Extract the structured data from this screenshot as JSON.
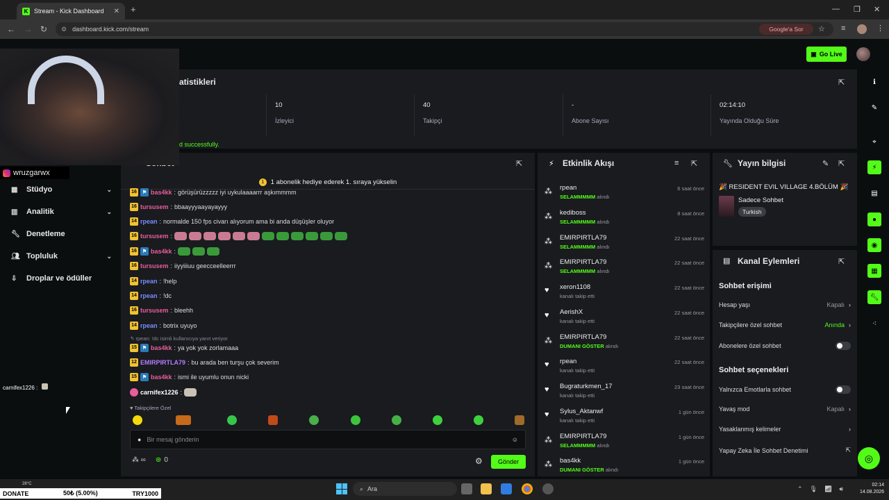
{
  "browser": {
    "tab_title": "Stream - Kick Dashboard",
    "url": "dashboard.kick.com/stream",
    "google_sor": "Google'a Sor"
  },
  "header": {
    "go_live": "Go Live"
  },
  "overlay": {
    "instagram": "wruzgarwx",
    "cam_feed_user": "carnifex1226 :",
    "donate": {
      "label": "DONATE",
      "progress": "50₺ (5.00%)",
      "goal": "TRY1000"
    },
    "weather": "28°C"
  },
  "nav": {
    "items": [
      {
        "label": "Stüdyo",
        "icon": "studio-icon",
        "has_chevron": true
      },
      {
        "label": "Analitik",
        "icon": "chart-icon",
        "has_chevron": true
      },
      {
        "label": "Denetleme",
        "icon": "wrench-icon",
        "has_chevron": false
      },
      {
        "label": "Topluluk",
        "icon": "people-icon",
        "has_chevron": true
      },
      {
        "label": "Droplar ve ödüller",
        "icon": "drops-icon",
        "has_chevron": false
      }
    ]
  },
  "stats": {
    "title": "atistikleri",
    "items": [
      {
        "value": "10",
        "label": "İzleyici"
      },
      {
        "value": "40",
        "label": "Takipçi"
      },
      {
        "value": "-",
        "label": "Abone Sayısı"
      },
      {
        "value": "02:14:10",
        "label": "Yayında Olduğu Süre"
      }
    ],
    "status": "d successfully."
  },
  "chat": {
    "title": "Sohbet",
    "gift_banner": "1 abonelik hediye ederek 1. sıraya yükselin",
    "messages": [
      {
        "badge": "16",
        "kick": true,
        "user": "bas4kk",
        "text": "görüşürüzzzzz iyi uykulaaaarrr aşkımmmm",
        "color": "#e85d9c"
      },
      {
        "badge": "16",
        "kick": false,
        "user": "tursusem",
        "text": "bbaayyyaayayayyy",
        "color": "#e85d9c"
      },
      {
        "badge": "14",
        "kick": false,
        "user": "rpean",
        "text": "normalde 150 fps civarı alıyorum ama bi anda düşüşler oluyor",
        "color": "#7b8cff"
      },
      {
        "badge": "16",
        "kick": false,
        "user": "tursusem",
        "text": "",
        "color": "#e85d9c"
      },
      {
        "badge": "16",
        "kick": true,
        "user": "bas4kk",
        "text": "",
        "color": "#e85d9c"
      },
      {
        "badge": "16",
        "kick": false,
        "user": "tursusem",
        "text": "iiyyiiiuu geecceelleerrr",
        "color": "#e85d9c"
      },
      {
        "badge": "14",
        "kick": false,
        "user": "rpean",
        "text": "!help",
        "color": "#7b8cff"
      },
      {
        "badge": "14",
        "kick": false,
        "user": "rpean",
        "text": "!dc",
        "color": "#7b8cff"
      },
      {
        "badge": "16",
        "kick": false,
        "user": "tursusem",
        "text": "bleehh",
        "color": "#e85d9c"
      },
      {
        "badge": "14",
        "kick": false,
        "user": "rpean",
        "text": "botrix uyuyo",
        "color": "#7b8cff"
      },
      {
        "badge": "15",
        "kick": true,
        "user": "bas4kk",
        "text": "ya yok yok zorlamaaa",
        "color": "#e85d9c"
      },
      {
        "badge": "12",
        "kick": false,
        "user": "EMIRPIRTLA79",
        "text": "bu arada ben turşu çok severim",
        "color": "#b67bff"
      },
      {
        "badge": "15",
        "kick": true,
        "user": "bas4kk",
        "text": "ismi ile uyumlu onun nicki",
        "color": "#e85d9c"
      },
      {
        "badge": "",
        "kick": false,
        "user": "carnifex1226",
        "text": "",
        "color": "#ffffff"
      }
    ],
    "reply_hint": "↰ rpean: !dc isimli kullanıcıya yanıt veriyor",
    "follow_only": "♥ Takipçilere Özel",
    "input_placeholder": "Bir mesaj gönderin",
    "points": "0",
    "send": "Gönder"
  },
  "feed": {
    "title": "Etkinlik Akışı",
    "items": [
      {
        "type": "points",
        "user": "rpean",
        "reward": "SELAMMMMM",
        "suffix": " alındı",
        "time": "6 saat önce"
      },
      {
        "type": "points",
        "user": "kediboss",
        "reward": "SELAMMMMM",
        "suffix": " alındı",
        "time": "8 saat önce"
      },
      {
        "type": "points",
        "user": "EMIRPIRTLA79",
        "reward": "SELAMMMMM",
        "suffix": " alındı",
        "time": "22 saat önce"
      },
      {
        "type": "points",
        "user": "EMIRPIRTLA79",
        "reward": "SELAMMMMM",
        "suffix": " alındı",
        "time": "22 saat önce"
      },
      {
        "type": "follow",
        "user": "xeron1108",
        "reward": "",
        "suffix": "kanalı takip etti",
        "time": "22 saat önce"
      },
      {
        "type": "follow",
        "user": "AerishX",
        "reward": "",
        "suffix": "kanalı takip etti",
        "time": "22 saat önce"
      },
      {
        "type": "points",
        "user": "EMIRPIRTLA79",
        "reward": "DUMANI GÖSTER",
        "suffix": " alındı",
        "time": "22 saat önce"
      },
      {
        "type": "follow",
        "user": "rpean",
        "reward": "",
        "suffix": "kanalı takip etti",
        "time": "22 saat önce"
      },
      {
        "type": "follow",
        "user": "Bugraturkmen_17",
        "reward": "",
        "suffix": "kanalı takip etti",
        "time": "23 saat önce"
      },
      {
        "type": "follow",
        "user": "Sylus_Aktanwf",
        "reward": "",
        "suffix": "kanalı takip etti",
        "time": "1 gün önce"
      },
      {
        "type": "points",
        "user": "EMIRPIRTLA79",
        "reward": "SELAMMMMM",
        "suffix": " alındı",
        "time": "1 gün önce"
      },
      {
        "type": "points",
        "user": "bas4kk",
        "reward": "DUMANI GÖSTER",
        "suffix": " alındı",
        "time": "1 gün önce"
      }
    ]
  },
  "stream_info": {
    "title": "Yayın bilgisi",
    "stream_title": "🎉 RESIDENT EVIL VILLAGE 4.BÖLÜM 🎉",
    "chat_mode": "Sadece Sohbet",
    "language": "Turkish"
  },
  "actions": {
    "title": "Kanal Eylemleri",
    "access_title": "Sohbet erişimi",
    "account_age": {
      "label": "Hesap yaşı",
      "value": "Kapalı"
    },
    "followers_only": {
      "label": "Takipçilere özel sohbet",
      "value": "Anında"
    },
    "subs_only": {
      "label": "Abonelere özel sohbet"
    },
    "options_title": "Sohbet seçenekleri",
    "emote_only": {
      "label": "Yalnızca Emotlarla sohbet"
    },
    "slow_mode": {
      "label": "Yavaş mod",
      "value": "Kapalı"
    },
    "banned_words": {
      "label": "Yasaklanmış kelimeler"
    },
    "ai_moderation": {
      "label": "Yapay Zeka İle Sohbet Denetimi"
    }
  },
  "taskbar": {
    "search": "Ara",
    "time": "02:14",
    "date": "14.08.2026"
  },
  "colors": {
    "accent": "#53fc18",
    "panel": "#191b1f",
    "bg": "#0b0e0f"
  }
}
